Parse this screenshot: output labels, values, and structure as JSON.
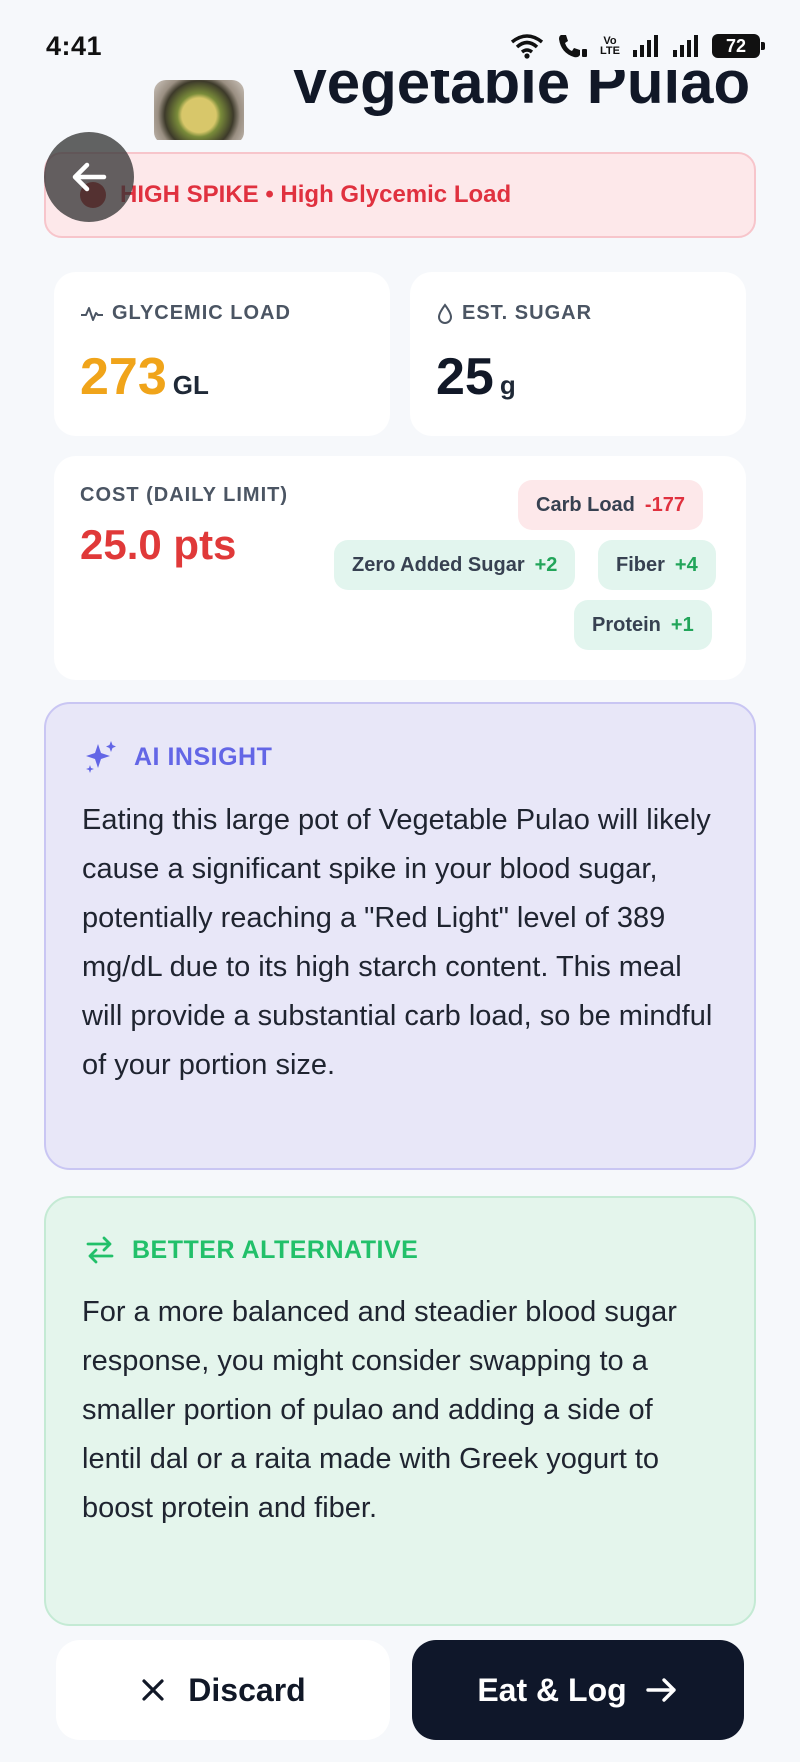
{
  "status_bar": {
    "time": "4:41",
    "volte_top": "Vo",
    "volte_bottom": "LTE",
    "battery": "72"
  },
  "header": {
    "title": "Vegetable Pulao"
  },
  "alert": {
    "text": "HIGH SPIKE • High Glycemic Load"
  },
  "metrics": {
    "glycemic": {
      "label": "GLYCEMIC LOAD",
      "value": "273",
      "unit": "GL",
      "color": "#f0a41a"
    },
    "sugar": {
      "label": "EST. SUGAR",
      "value": "25",
      "unit": "g"
    }
  },
  "cost": {
    "label": "COST (DAILY LIMIT)",
    "value": "25.0 pts",
    "chips": [
      {
        "label": "Carb Load",
        "delta": "-177",
        "kind": "neg"
      },
      {
        "label": "Zero Added Sugar",
        "delta": "+2",
        "kind": "pos"
      },
      {
        "label": "Fiber",
        "delta": "+4",
        "kind": "pos"
      },
      {
        "label": "Protein",
        "delta": "+1",
        "kind": "pos"
      }
    ]
  },
  "ai_insight": {
    "title": "AI INSIGHT",
    "body": "Eating this large pot of Vegetable Pulao will likely cause a significant spike in your blood sugar, potentially reaching a \"Red Light\" level of 389 mg/dL due to its high starch content. This meal will provide a substantial carb load, so be mindful of your portion size."
  },
  "better_alternative": {
    "title": "BETTER ALTERNATIVE",
    "body": "For a more balanced and steadier blood sugar response, you might consider swapping to a smaller portion of pulao and adding a side of lentil dal or a raita made with Greek yogurt to boost protein and fiber."
  },
  "actions": {
    "discard": "Discard",
    "eat_log": "Eat & Log"
  }
}
